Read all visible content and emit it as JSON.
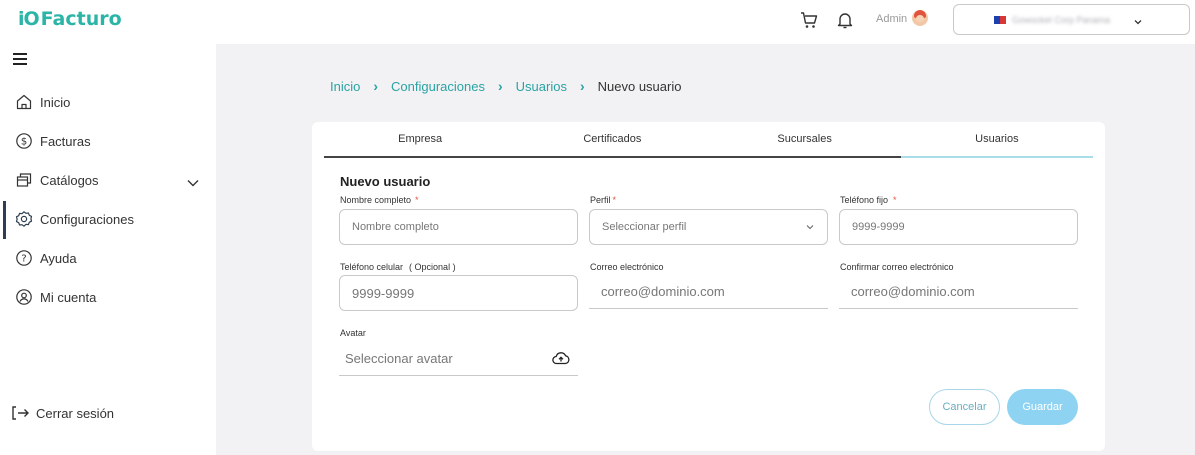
{
  "app": {
    "logo_mark": "iO",
    "logo_text": "Facturo"
  },
  "header": {
    "user_name": "Admin",
    "company_name": "Gowocket Corp Panama",
    "icons": [
      "cart-icon",
      "bell-icon",
      "avatar",
      "chevron-down-icon"
    ]
  },
  "sidebar": {
    "items": [
      {
        "label": "Inicio",
        "icon": "home-icon"
      },
      {
        "label": "Facturas",
        "icon": "dollar-circle-icon"
      },
      {
        "label": "Catálogos",
        "icon": "catalog-icon"
      },
      {
        "label": "Configuraciones",
        "icon": "gear-icon",
        "active": true
      },
      {
        "label": "Ayuda",
        "icon": "help-icon"
      },
      {
        "label": "Mi cuenta",
        "icon": "account-icon"
      }
    ],
    "logout_label": "Cerrar sesión"
  },
  "breadcrumb": {
    "items": [
      "Inicio",
      "Configuraciones",
      "Usuarios"
    ],
    "current": "Nuevo usuario"
  },
  "tabs": [
    {
      "label": "Empresa"
    },
    {
      "label": "Certificados"
    },
    {
      "label": "Sucursales"
    },
    {
      "label": "Usuarios",
      "active": true
    }
  ],
  "form": {
    "title": "Nuevo usuario",
    "full_name": {
      "label": "Nombre completo",
      "required": "*",
      "placeholder": "Nombre completo"
    },
    "profile": {
      "label": "Perfil",
      "required": "*",
      "placeholder": "Seleccionar perfil"
    },
    "landline": {
      "label": "Teléfono fijo",
      "required": "*",
      "placeholder": "9999-9999"
    },
    "mobile": {
      "label": "Teléfono celular",
      "optional": "( Opcional )",
      "placeholder": "9999-9999"
    },
    "email": {
      "label": "Correo electrónico",
      "placeholder": "correo@dominio.com"
    },
    "confirm_email": {
      "label": "Confirmar correo electrónico",
      "placeholder": "correo@dominio.com"
    },
    "avatar": {
      "label": "Avatar",
      "placeholder": "Seleccionar avatar"
    },
    "cancel_label": "Cancelar",
    "save_label": "Guardar"
  },
  "colors": {
    "brand": "#2bb5a7",
    "link": "#2aa3a3",
    "save_button": "#8fd3f2",
    "required": "#e0533f"
  }
}
